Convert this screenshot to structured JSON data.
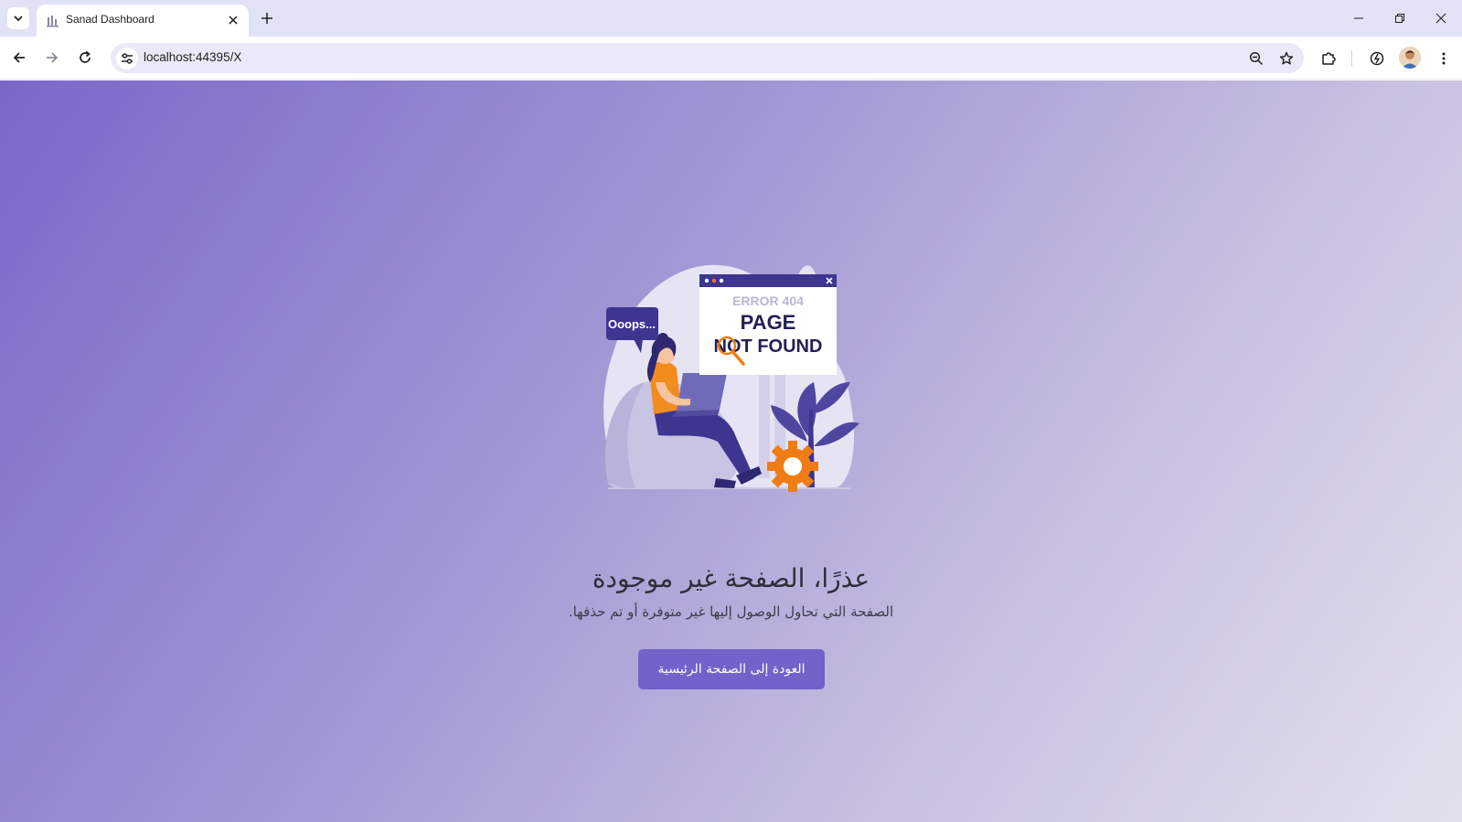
{
  "browser": {
    "tab_title": "Sanad Dashboard",
    "url": "localhost:44395/X"
  },
  "illustration": {
    "speech_bubble": "Ooops...",
    "error_code": "ERROR 404",
    "line1": "PAGE",
    "line2": "NOT FOUND"
  },
  "content": {
    "headline": "عذرًا، الصفحة غير موجودة",
    "subline": "الصفحة التي تحاول الوصول إليها غير متوفرة أو تم حذفها.",
    "home_button": "العودة إلى الصفحة الرئيسية"
  },
  "colors": {
    "accent": "#7262c9",
    "gradient_start": "#7a68c9",
    "gradient_end": "#e2e0ec"
  }
}
